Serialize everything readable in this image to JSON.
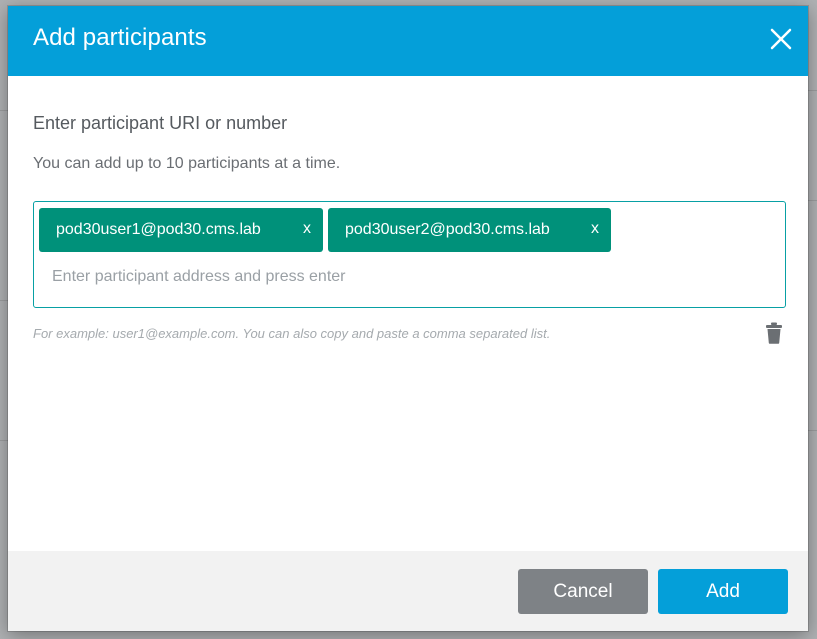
{
  "dialog": {
    "title": "Add participants",
    "section_label": "Enter participant URI or number",
    "help_text": "You can add up to 10 participants at a time.",
    "participants": [
      {
        "address": "pod30user1@pod30.cms.lab",
        "remove_label": "x"
      },
      {
        "address": "pod30user2@pod30.cms.lab",
        "remove_label": "x"
      }
    ],
    "input": {
      "value": "",
      "placeholder": "Enter participant address and press enter"
    },
    "example_text": "For example: user1@example.com. You can also copy and paste a comma separated list.",
    "buttons": {
      "cancel": "Cancel",
      "add": "Add"
    }
  },
  "colors": {
    "header": "#049fd9",
    "chip": "#00917a",
    "input_border": "#08a0a4",
    "cancel_button": "#7e8286",
    "add_button": "#049fd9"
  },
  "icons": {
    "close": "close-icon",
    "trash": "trash-icon"
  }
}
